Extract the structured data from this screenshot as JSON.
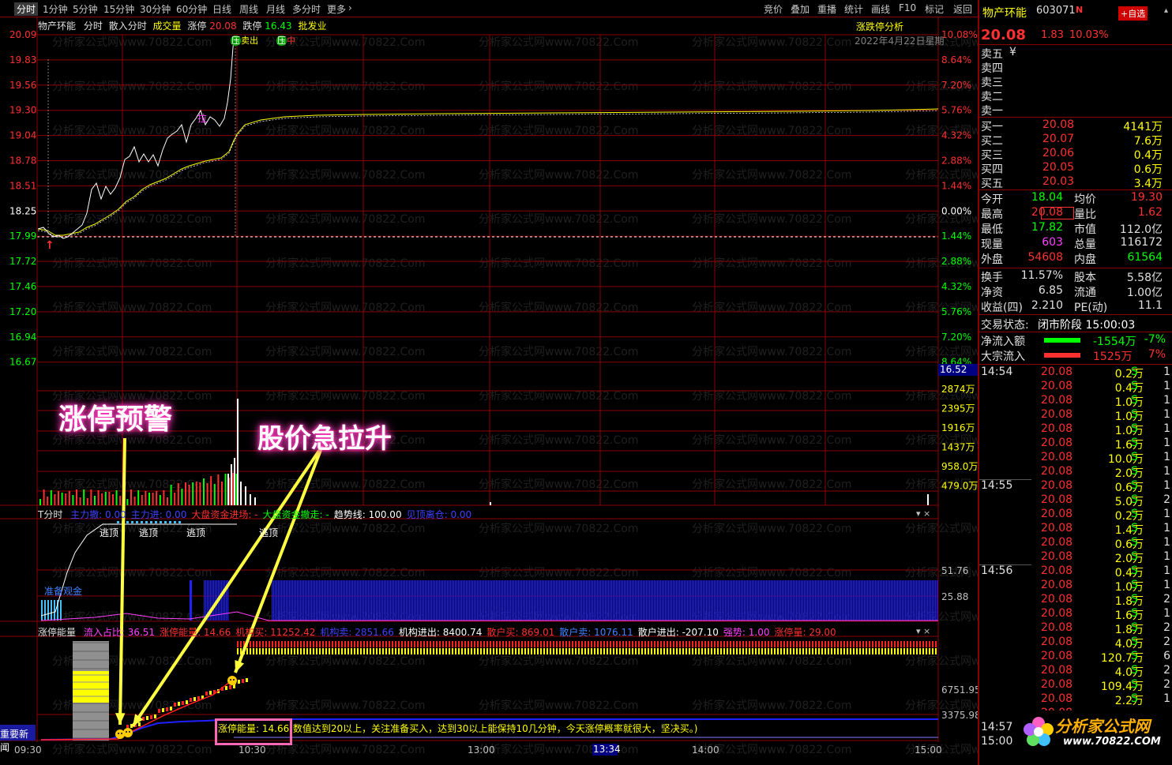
{
  "toolbar": {
    "tabs": [
      "分时",
      "1分钟",
      "5分钟",
      "15分钟",
      "30分钟",
      "60分钟",
      "日线",
      "周线",
      "月线",
      "多分时",
      "更多"
    ],
    "right": [
      "竞价",
      "叠加",
      "重播",
      "统计",
      "画线",
      "F10",
      "标记",
      "返回"
    ]
  },
  "chart": {
    "stock": "物产环能",
    "mode": "分时",
    "mode2": "散入分时",
    "vol_label": "成交量",
    "zt_label": "涨停",
    "zt": "20.08",
    "dt_label": "跌停",
    "dt": "16.43",
    "pifa": "批发业",
    "analysis": "涨跌停分析",
    "date": "2022年4月22日星期",
    "cursor_price": "16.52",
    "cursor_time": "13:34"
  },
  "price_axis": [
    "20.09",
    "19.83",
    "19.56",
    "19.30",
    "19.04",
    "18.78",
    "18.51",
    "18.25",
    "17.99",
    "17.72",
    "17.46",
    "17.20",
    "16.94",
    "16.67"
  ],
  "pct_axis": [
    "10.08%",
    "8.64%",
    "7.20%",
    "5.76%",
    "4.32%",
    "2.88%",
    "1.44%",
    "0.00%",
    "1.44%",
    "2.88%",
    "4.32%",
    "5.76%",
    "7.20%",
    "8.64%"
  ],
  "vol_axis": [
    "2874万",
    "2395万",
    "1916万",
    "1437万",
    "958.0万",
    "479.0万"
  ],
  "marks": {
    "sell": "卖出",
    "ya": "压",
    "zhong": "中",
    "la": "拉"
  },
  "ind1": {
    "name": "T分时",
    "items": [
      {
        "t": "主力撤: 0.00",
        "c": "#4040ff"
      },
      {
        "t": "主力进: 0.00",
        "c": "#4040ff"
      },
      {
        "t": "大盘资金进场: -",
        "c": "#ff3030"
      },
      {
        "t": "大盘资金撤走: -",
        "c": "#00ff00"
      },
      {
        "t": "趋势线: 100.00",
        "c": "#ffffff"
      },
      {
        "t": "见顶离仓: 0.00",
        "c": "#4040ff"
      }
    ],
    "axis": [
      "51.76",
      "25.88"
    ],
    "tops": [
      "逃顶",
      "逃顶",
      "逃顶",
      "逃顶"
    ],
    "ready": "准备观金"
  },
  "ind2": {
    "name": "涨停能量",
    "items": [
      {
        "t": "流入占比: 36.51",
        "c": "#ff40ff"
      },
      {
        "t": "涨停能量: 14.66",
        "c": "#ff3030"
      },
      {
        "t": "机构买: 11252.42",
        "c": "#ff3030"
      },
      {
        "t": "机构卖: 2851.66",
        "c": "#4040ff"
      },
      {
        "t": "机构进出: 8400.74",
        "c": "#ffffff"
      },
      {
        "t": "散户买: 869.01",
        "c": "#ff3030"
      },
      {
        "t": "散户卖: 1076.11",
        "c": "#4080ff"
      },
      {
        "t": "散户进出: -207.10",
        "c": "#ffffff"
      },
      {
        "t": "强势: 1.00",
        "c": "#ff40ff"
      },
      {
        "t": "涨停量: 29.00",
        "c": "#ff3030"
      }
    ],
    "axis": [
      "6751.95",
      "3375.98"
    ]
  },
  "news": "重要新闻",
  "note": {
    "label": "涨停能量: 14.66",
    "text": "(数值达到20以上，关注准备买入，达到30以上能保持10几分钟，今天涨停概率就很大，坚决买。)"
  },
  "time_axis": [
    "09:30",
    "10:30",
    "13:00",
    "14:00",
    "15:00"
  ],
  "annotations": {
    "a1": "涨停预警",
    "a2": "股价急拉升"
  },
  "quote": {
    "name": "物产环能",
    "code": "603071",
    "badge": "N",
    "add": "+自选",
    "price": "20.08",
    "change": "1.83",
    "pct": "10.03%"
  },
  "asks": [
    {
      "l": "卖五",
      "v": "¥"
    },
    {
      "l": "卖四",
      "v": ""
    },
    {
      "l": "卖三",
      "v": ""
    },
    {
      "l": "卖二",
      "v": ""
    },
    {
      "l": "卖一",
      "v": ""
    }
  ],
  "bids": [
    {
      "l": "买一",
      "p": "20.08",
      "v": "4141万"
    },
    {
      "l": "买二",
      "p": "20.07",
      "v": "7.6万"
    },
    {
      "l": "买三",
      "p": "20.06",
      "v": "0.4万"
    },
    {
      "l": "买四",
      "p": "20.05",
      "v": "0.6万"
    },
    {
      "l": "买五",
      "p": "20.03",
      "v": "3.4万"
    }
  ],
  "stats": [
    {
      "l1": "今开",
      "v1": "18.04",
      "c1": "#00ff00",
      "l2": "均价",
      "v2": "19.30",
      "c2": "#ff3030"
    },
    {
      "l1": "最高",
      "v1": "20.08",
      "c1": "#ff3030",
      "l2": "量比",
      "v2": "1.62",
      "c2": "#ff3030"
    },
    {
      "l1": "最低",
      "v1": "17.82",
      "c1": "#00ff00",
      "l2": "市值",
      "v2": "112.0亿",
      "c2": "#e0e0e0"
    },
    {
      "l1": "现量",
      "v1": "603",
      "c1": "#ff40ff",
      "l2": "总量",
      "v2": "116172",
      "c2": "#e0e0e0"
    },
    {
      "l1": "外盘",
      "v1": "54608",
      "c1": "#ff3030",
      "l2": "内盘",
      "v2": "61564",
      "c2": "#00ff00"
    },
    {
      "l1": "换手",
      "v1": "11.57%",
      "c1": "#e0e0e0",
      "l2": "股本",
      "v2": "5.58亿",
      "c2": "#e0e0e0"
    },
    {
      "l1": "净资",
      "v1": "6.85",
      "c1": "#e0e0e0",
      "l2": "流通",
      "v2": "1.00亿",
      "c2": "#e0e0e0"
    },
    {
      "l1": "收益(四)",
      "v1": "2.210",
      "c1": "#e0e0e0",
      "l2": "PE(动)",
      "v2": "11.1",
      "c2": "#e0e0e0"
    }
  ],
  "trade_state": {
    "label": "交易状态:",
    "value": "闭市阶段 15:00:03"
  },
  "flows": [
    {
      "l": "净流入额",
      "v": "-1554万",
      "p": "-7%",
      "c": "#00ff00"
    },
    {
      "l": "大宗流入",
      "v": "1525万",
      "p": "7%",
      "c": "#ff3030"
    }
  ],
  "ticks": [
    {
      "t": "14:54",
      "p": "20.08",
      "v": "0.2万",
      "s": "S",
      "n": "1"
    },
    {
      "t": "",
      "p": "20.08",
      "v": "0.4万",
      "s": "S",
      "n": "1"
    },
    {
      "t": "",
      "p": "20.08",
      "v": "1.0万",
      "s": "S",
      "n": "1"
    },
    {
      "t": "",
      "p": "20.08",
      "v": "1.0万",
      "s": "S",
      "n": "1"
    },
    {
      "t": "",
      "p": "20.08",
      "v": "1.0万",
      "s": "S",
      "n": "1"
    },
    {
      "t": "",
      "p": "20.08",
      "v": "1.6万",
      "s": "S",
      "n": "1"
    },
    {
      "t": "",
      "p": "20.08",
      "v": "10.0万",
      "s": "S",
      "n": "1"
    },
    {
      "t": "",
      "p": "20.08",
      "v": "2.0万",
      "s": "S",
      "n": "1"
    },
    {
      "t": "14:55",
      "p": "20.08",
      "v": "0.6万",
      "s": "S",
      "n": "1"
    },
    {
      "t": "",
      "p": "20.08",
      "v": "5.0万",
      "s": "S",
      "n": "2"
    },
    {
      "t": "",
      "p": "20.08",
      "v": "0.2万",
      "s": "S",
      "n": "1"
    },
    {
      "t": "",
      "p": "20.08",
      "v": "1.4万",
      "s": "S",
      "n": "1"
    },
    {
      "t": "",
      "p": "20.08",
      "v": "0.6万",
      "s": "S",
      "n": "1"
    },
    {
      "t": "",
      "p": "20.08",
      "v": "2.0万",
      "s": "S",
      "n": "1"
    },
    {
      "t": "14:56",
      "p": "20.08",
      "v": "0.4万",
      "s": "S",
      "n": "1"
    },
    {
      "t": "",
      "p": "20.08",
      "v": "1.0万",
      "s": "S",
      "n": "1"
    },
    {
      "t": "",
      "p": "20.08",
      "v": "1.8万",
      "s": "S",
      "n": "2"
    },
    {
      "t": "",
      "p": "20.08",
      "v": "1.6万",
      "s": "S",
      "n": "1"
    },
    {
      "t": "",
      "p": "20.08",
      "v": "1.8万",
      "s": "S",
      "n": "2"
    },
    {
      "t": "",
      "p": "20.08",
      "v": "4.0万",
      "s": "S",
      "n": "2"
    },
    {
      "t": "",
      "p": "20.08",
      "v": "120.7万",
      "s": "S",
      "n": "6"
    },
    {
      "t": "",
      "p": "20.08",
      "v": "4.0万",
      "s": "S",
      "n": "2"
    },
    {
      "t": "",
      "p": "20.08",
      "v": "109.4万",
      "s": "S",
      "n": "2"
    },
    {
      "t": "",
      "p": "20.08",
      "v": "2.2万",
      "s": "S",
      "n": "1"
    },
    {
      "t": "",
      "p": "20.08",
      "v": "",
      "s": "",
      "n": ""
    },
    {
      "t": "14:57",
      "p": "",
      "v": "",
      "s": "",
      "n": ""
    },
    {
      "t": "15:00",
      "p": "",
      "v": "",
      "s": "",
      "n": ""
    }
  ],
  "logo": {
    "text": "分析家公式网",
    "url": "www.70822.COM"
  },
  "watermark": "分析家公式网www.70822.Com",
  "colors": {
    "up": "#ff3030",
    "down": "#00ff00",
    "grid": "#8b0000",
    "price_line": "#ffffff",
    "avg_line": "#ffff00"
  }
}
